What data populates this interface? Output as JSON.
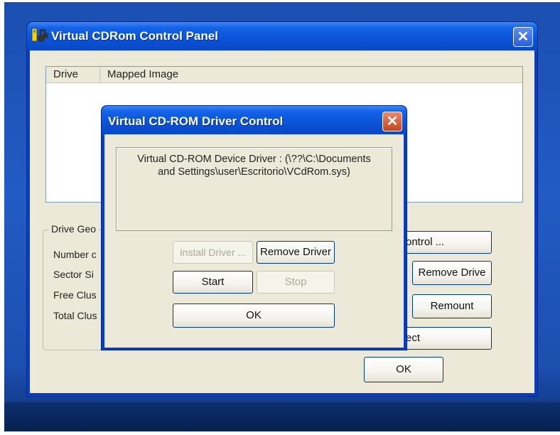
{
  "main_window": {
    "title": "Virtual CDRom Control Panel",
    "close_glyph": "✕",
    "list": {
      "columns": [
        "Drive",
        "Mapped Image"
      ]
    },
    "drive_geometry": {
      "label": "Drive Geo",
      "rows": [
        "Number c",
        "Sector Si",
        "Free Clus",
        "Total Clus"
      ]
    },
    "buttons": {
      "driver_control": "ontrol ...",
      "remove_drive": "Remove Drive",
      "remount": "Remount",
      "eject": "ect",
      "ok": "OK"
    }
  },
  "dialog": {
    "title": "Virtual CD-ROM Driver Control",
    "close_glyph": "✕",
    "driver_path_line1": "Virtual CD-ROM Device Driver : (\\??\\C:\\Documents",
    "driver_path_line2": "and Settings\\user\\Escritorio\\VCdRom.sys)",
    "buttons": {
      "install_driver": "Install Driver ...",
      "remove_driver": "Remove Driver",
      "start": "Start",
      "stop": "Stop",
      "ok": "OK"
    }
  },
  "colors": {
    "titlebar": "#0a52d8",
    "window_face": "#ece9d8",
    "close_dialog": "#c8431f"
  },
  "icons": {
    "app": "cd-music-icon",
    "close": "close-icon"
  }
}
